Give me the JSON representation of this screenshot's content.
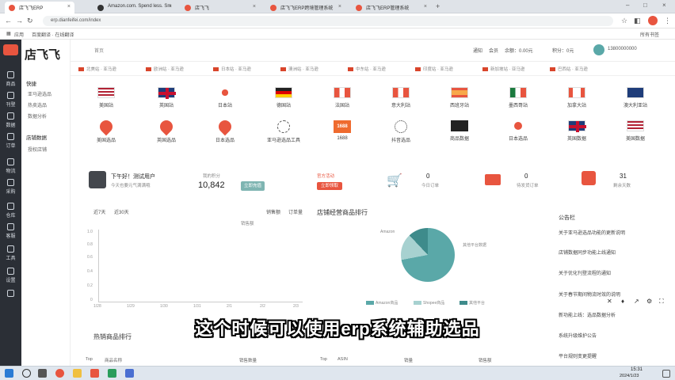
{
  "browser": {
    "tabs": [
      {
        "label": "店飞飞ERP"
      },
      {
        "label": "Amazon.com. Spend less. Sm"
      },
      {
        "label": "店飞飞"
      },
      {
        "label": "店飞飞ERP跨境管理系统"
      },
      {
        "label": "店飞飞ERP管理系统"
      }
    ],
    "url": "erp.dianfeifei.com/index",
    "bookmarks": [
      "应用",
      "百度翻译 · 在线翻译"
    ],
    "bookmarks_right": "所有书签"
  },
  "sidebar": {
    "logo": "店飞飞",
    "items": [
      {
        "label": "商品"
      },
      {
        "label": "刊登"
      },
      {
        "label": "数据"
      },
      {
        "label": "订单"
      },
      {
        "label": "物流"
      },
      {
        "label": "采购"
      },
      {
        "label": "仓库"
      },
      {
        "label": "客服"
      },
      {
        "label": "工具"
      },
      {
        "label": "设置"
      }
    ]
  },
  "subnav": {
    "header": "首页",
    "group1_title": "快捷",
    "group1": [
      "亚马逊选品",
      "热卖选品",
      "数据分析"
    ],
    "group2_title": "店铺数据",
    "group2": [
      "授权店铺"
    ]
  },
  "header": {
    "breadcrumb": "首页",
    "right_items": [
      "通知",
      "会员",
      "余额：0.00元",
      "积分：0元"
    ],
    "user": "13800000000"
  },
  "flag_strip": [
    "北美站 · 亚马逊",
    "欧洲站 · 亚马逊",
    "日本站 · 亚马逊",
    "澳洲站 · 亚马逊",
    "中东站 · 亚马逊",
    "印度站 · 亚马逊",
    "新加坡站 · 亚马逊",
    "巴西站 · 亚马逊"
  ],
  "marketplaces": [
    {
      "label": "美国站",
      "flag": "us"
    },
    {
      "label": "英国站",
      "flag": "uk"
    },
    {
      "label": "日本站",
      "flag": "jp"
    },
    {
      "label": "德国站",
      "flag": "de"
    },
    {
      "label": "法国站",
      "flag": "fr"
    },
    {
      "label": "意大利站",
      "flag": "it"
    },
    {
      "label": "西班牙站",
      "flag": "es"
    },
    {
      "label": "墨西哥站",
      "flag": "mx"
    },
    {
      "label": "加拿大站",
      "flag": "ca"
    },
    {
      "label": "澳大利亚站",
      "flag": "au"
    }
  ],
  "tools": [
    {
      "label": "美国选品",
      "kind": "pin"
    },
    {
      "label": "英国选品",
      "kind": "pin"
    },
    {
      "label": "日本选品",
      "kind": "pin"
    },
    {
      "label": "亚马逊选品工具",
      "kind": "circle-dash"
    },
    {
      "label": "1688",
      "kind": "logo1688"
    },
    {
      "label": "抖音选品",
      "kind": "round"
    },
    {
      "label": "商品数据",
      "kind": "dark"
    },
    {
      "label": "日本选品",
      "kind": "dot"
    },
    {
      "label": "英国数据",
      "kind": "uk"
    },
    {
      "label": "美国数据",
      "kind": "us"
    }
  ],
  "stats": {
    "user_greeting": "下午好！测试用户",
    "user_sub": "今天也要元气满满哦",
    "fans_label": "我的积分",
    "fans_value": "10,842",
    "fans_button": "立即充值",
    "promo_tag": "官方活动",
    "promo_button": "立即领取",
    "orders_value": "0",
    "orders_label": "今日订单",
    "shipping_value": "0",
    "shipping_label": "待发货订单",
    "calendar_value": "31",
    "calendar_label": "剩余天数"
  },
  "line_chart": {
    "tabs": [
      "近7天",
      "近30天"
    ],
    "options": [
      "销售额",
      "订单量"
    ],
    "legend": "销售额",
    "yticks": [
      "1.0",
      "0.8",
      "0.6",
      "0.4",
      "0.2",
      "0"
    ],
    "xticks": [
      "1/28",
      "1/29",
      "1/30",
      "1/31",
      "2/1",
      "2/2",
      "2/3"
    ]
  },
  "pie": {
    "title": "店铺经营商品排行",
    "label_left": "Amazon",
    "label_right": "其他平台数据",
    "legend": [
      "Amazon商品",
      "Shopee商品",
      "其他平台"
    ]
  },
  "announcements": {
    "title": "公告栏",
    "items": [
      "关于亚马逊选品功能的更新说明",
      "店铺数据同步功能上线通知",
      "关于优化刊登流程的通知",
      "关于春节期间物流时效的说明",
      "新功能上线：选品数据分析",
      "系统升级维护公告",
      "平台规则变更提醒"
    ]
  },
  "bottom_table": {
    "title": "热销商品排行",
    "cols_left": [
      "Top",
      "商品名称",
      "销售数量"
    ],
    "cols_right": [
      "Top",
      "ASIN",
      "销量",
      "销售额"
    ]
  },
  "subtitle": "这个时候可以使用erp系统辅助选品",
  "taskbar": {
    "time": "15:31",
    "date": "2024/1/23"
  },
  "colors": {
    "sidebar": "#2b2f36",
    "brand_red": "#e8553f",
    "pie_teal": "#5aa8a8",
    "btn_teal": "#7fb5b2"
  }
}
